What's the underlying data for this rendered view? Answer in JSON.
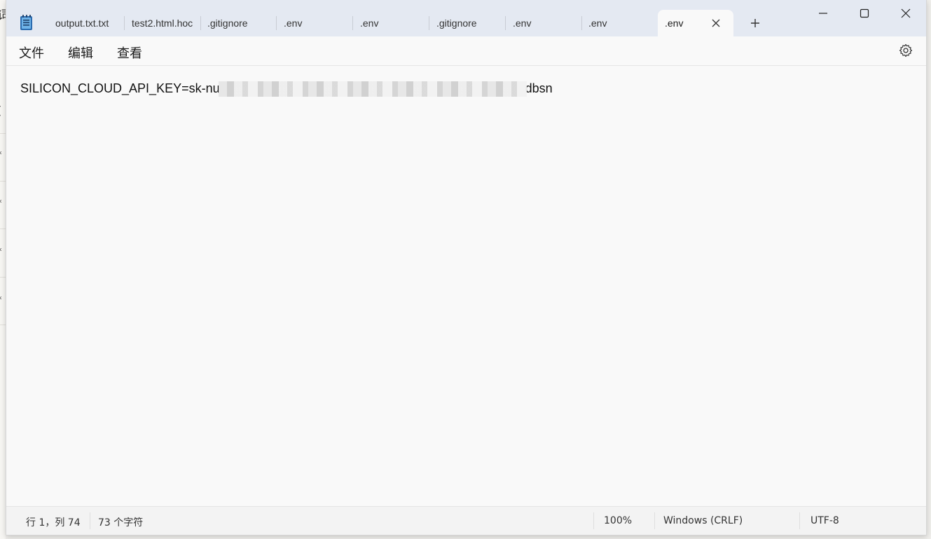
{
  "background_window": {
    "glyphs": [
      "词",
      "(",
      "*",
      "*",
      "*",
      "*"
    ]
  },
  "app": {
    "icon": "notepad-icon"
  },
  "tabs": [
    {
      "label": "output.txt.txt",
      "active": false
    },
    {
      "label": "test2.html.hoc",
      "active": false
    },
    {
      "label": ".gitignore",
      "active": false
    },
    {
      "label": ".env",
      "active": false
    },
    {
      "label": ".env",
      "active": false
    },
    {
      "label": ".gitignore",
      "active": false
    },
    {
      "label": ".env",
      "active": false
    },
    {
      "label": ".env",
      "active": false
    },
    {
      "label": ".env",
      "active": true
    }
  ],
  "window_controls": {
    "minimize": "minimize-icon",
    "maximize": "maximize-icon",
    "close": "close-icon"
  },
  "menu": {
    "file": "文件",
    "edit": "编辑",
    "view": "查看",
    "settings_icon": "gear-icon"
  },
  "editor": {
    "text_prefix": "SILICON_CLOUD_API_KEY=sk-nu",
    "text_suffix": "dbsn"
  },
  "status": {
    "position": "行 1，列 74",
    "char_count": "73 个字符",
    "zoom": "100%",
    "line_ending": "Windows (CRLF)",
    "encoding": "UTF-8"
  },
  "colors": {
    "titlebar": "#e4e9f2",
    "editor_bg": "#f9f9f9",
    "statusbar": "#f3f3f3"
  }
}
